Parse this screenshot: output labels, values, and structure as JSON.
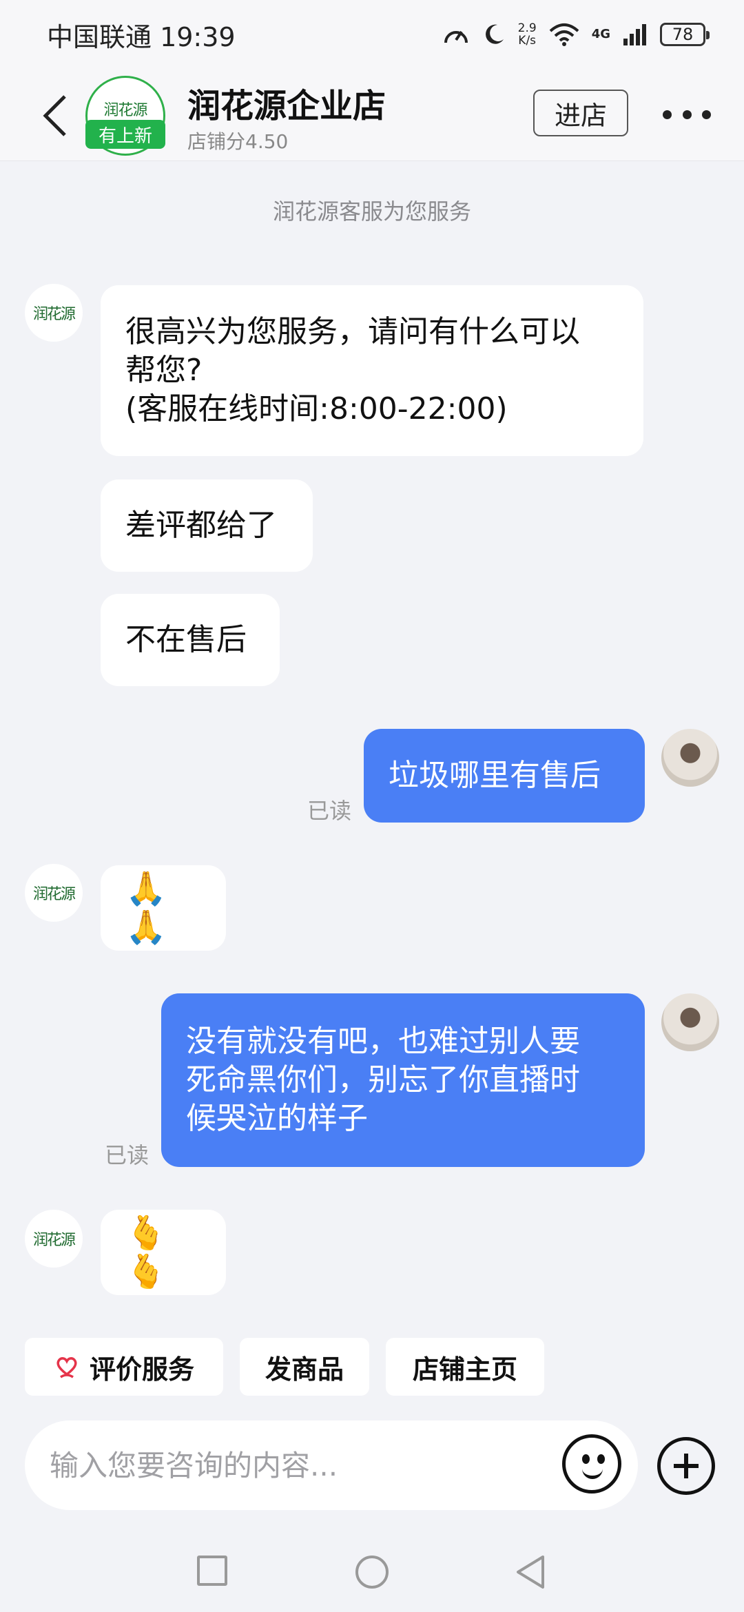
{
  "status_bar": {
    "carrier_time": "中国联通 19:39",
    "speed_value": "2.9",
    "speed_unit": "K/s",
    "network": "4G",
    "battery": "78"
  },
  "header": {
    "shop_name": "润花源企业店",
    "shop_score": "店铺分4.50",
    "avatar_badge": "有上新",
    "enter_label": "进店",
    "logo_text": "润花源",
    "icons": [
      "back-icon",
      "more-icon"
    ]
  },
  "service_note": "润花源客服为您服务",
  "messages": [
    {
      "from": "shop",
      "lines": [
        "很高兴为您服务，请问有什么可以",
        "帮您?",
        "(客服在线时间:8:00-22:00)"
      ]
    },
    {
      "from": "shop",
      "text": "差评都给了"
    },
    {
      "from": "shop",
      "text": "不在售后"
    },
    {
      "from": "me",
      "text": "垃圾哪里有售后",
      "status": "已读"
    },
    {
      "from": "shop",
      "text": "🙏🙏"
    },
    {
      "from": "me",
      "lines": [
        "没有就没有吧，也难过别人要",
        "死命黑你们，别忘了你直播时",
        "候哭泣的样子"
      ],
      "status": "已读"
    },
    {
      "from": "shop",
      "text": "🫰🫰"
    }
  ],
  "quick_actions": [
    {
      "label": "评价服务",
      "icon": "heart-hand-icon"
    },
    {
      "label": "发商品"
    },
    {
      "label": "店铺主页"
    }
  ],
  "input": {
    "placeholder": "输入您要咨询的内容..."
  },
  "colors": {
    "accent_bubble": "#4a7ff5",
    "badge_green": "#22b24c",
    "quick_icon": "#e5344a"
  }
}
